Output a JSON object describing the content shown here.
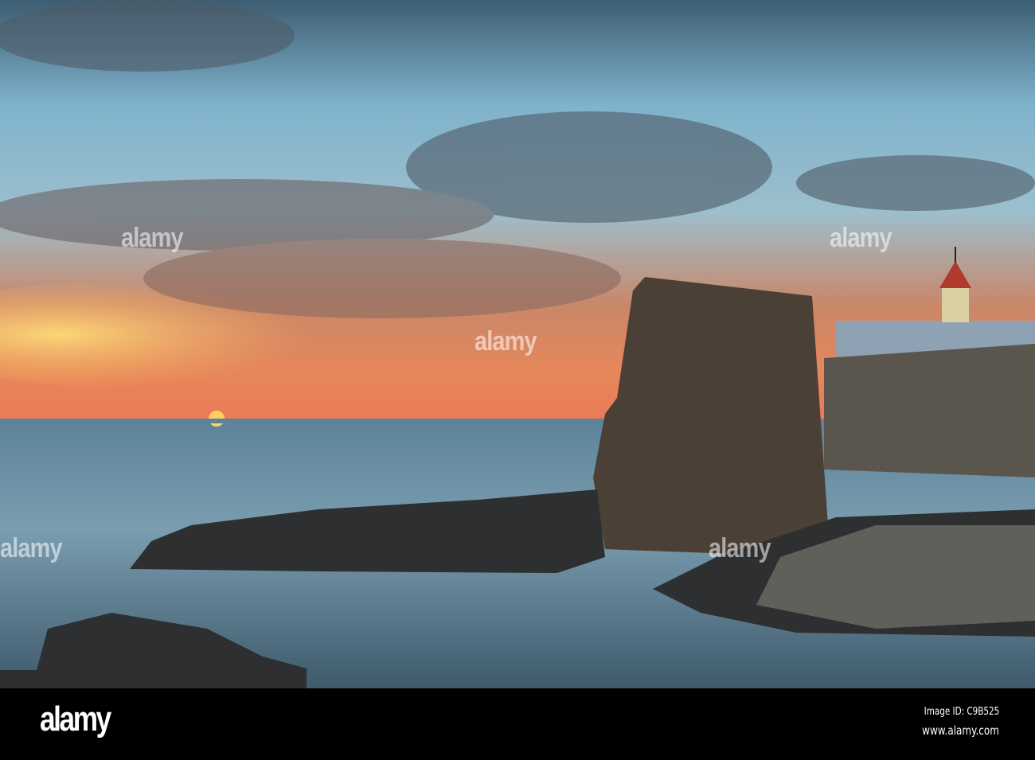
{
  "watermark": {
    "text": "alamy"
  },
  "footer": {
    "logo": "alamy",
    "image_id": "Image ID: C9B525",
    "url": "www.alamy.com"
  },
  "colors": {
    "sky_top": "#3d5d72",
    "sky_mid": "#8bbfd6",
    "horizon": "#f08a4a",
    "sea": "#6a8ea3",
    "ruin": "#4b4036"
  }
}
